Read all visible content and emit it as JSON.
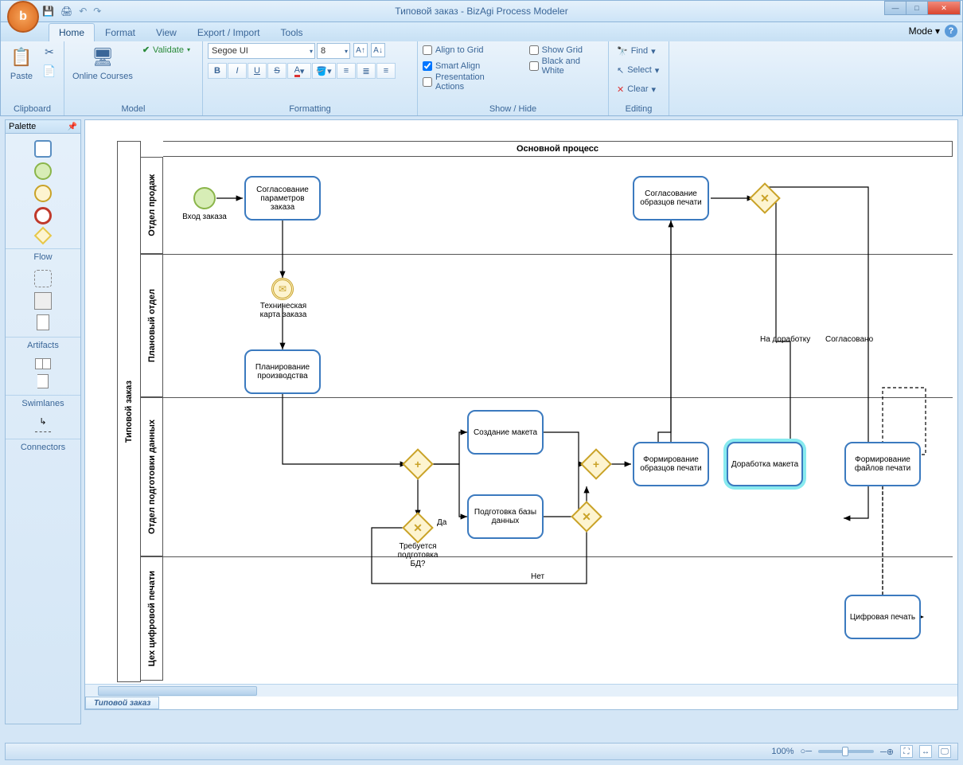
{
  "title": "Типовой заказ - BizAgi Process Modeler",
  "ribbon": {
    "tabs": [
      "Home",
      "Format",
      "View",
      "Export / Import",
      "Tools"
    ],
    "mode": "Mode",
    "groups": {
      "clipboard": "Clipboard",
      "model": "Model",
      "formatting": "Formatting",
      "showhide": "Show / Hide",
      "editing": "Editing"
    },
    "paste": "Paste",
    "online_courses": "Online Courses",
    "validate": "Validate",
    "font": "Segoe UI",
    "font_size": "8",
    "align_to_grid": "Align to Grid",
    "smart_align": "Smart Align",
    "presentation_actions": "Presentation Actions",
    "show_grid": "Show Grid",
    "black_and_white": "Black and White",
    "find": "Find",
    "select": "Select",
    "clear": "Clear"
  },
  "palette": {
    "title": "Palette",
    "flow": "Flow",
    "artifacts": "Artifacts",
    "swimlanes": "Swimlanes",
    "connectors": "Connectors"
  },
  "diagram": {
    "pool": "Типовой заказ",
    "process_title": "Основной процесс",
    "lanes": [
      "Отдел продаж",
      "Плановый отдел",
      "Отдел подготовки данных",
      "Цех цифровой печати"
    ],
    "start_label": "Вход заказа",
    "task_params": "Согласование параметров заказа",
    "msg_label": "Техническая карта заказа",
    "task_plan": "Планирование производства",
    "task_layout": "Создание макета",
    "task_db": "Подготовка базы данных",
    "gw_db_label": "Требуется подготовка БД?",
    "yes": "Да",
    "no": "Нет",
    "task_samples": "Формирование образцов печати",
    "task_approve_samples": "Согласование образцов печати",
    "task_rework": "Доработка макета",
    "to_rework": "На доработку",
    "agreed": "Согласовано",
    "task_files": "Формирование файлов печати",
    "task_print": "Цифровая печать"
  },
  "doc_tab": "Типовой заказ",
  "status": {
    "zoom": "100%"
  }
}
